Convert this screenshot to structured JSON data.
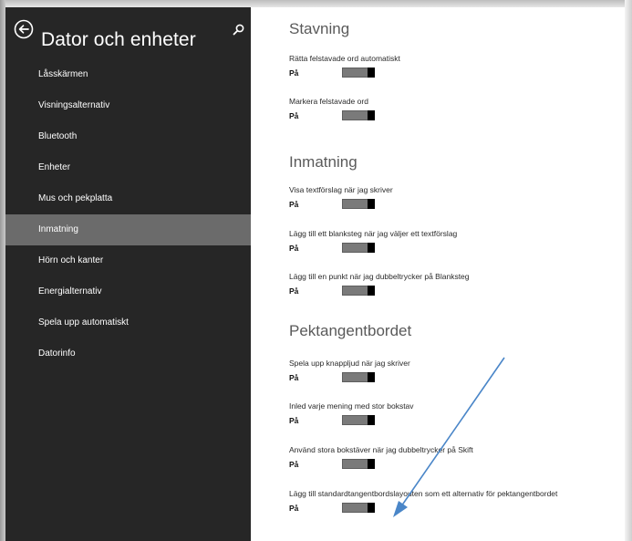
{
  "sidebar": {
    "title": "Dator och enheter",
    "back_icon": "back-arrow-circle-icon",
    "search_icon": "search-icon",
    "items": [
      {
        "label": "Låsskärmen",
        "active": false
      },
      {
        "label": "Visningsalternativ",
        "active": false
      },
      {
        "label": "Bluetooth",
        "active": false
      },
      {
        "label": "Enheter",
        "active": false
      },
      {
        "label": "Mus och pekplatta",
        "active": false
      },
      {
        "label": "Inmatning",
        "active": true
      },
      {
        "label": "Hörn och kanter",
        "active": false
      },
      {
        "label": "Energialternativ",
        "active": false
      },
      {
        "label": "Spela upp automatiskt",
        "active": false
      },
      {
        "label": "Datorinfo",
        "active": false
      }
    ]
  },
  "content": {
    "sections": [
      {
        "title": "Stavning",
        "settings": [
          {
            "label": "Rätta felstavade ord automatiskt",
            "state": "På",
            "on": true
          },
          {
            "label": "Markera felstavade ord",
            "state": "På",
            "on": true
          }
        ]
      },
      {
        "title": "Inmatning",
        "settings": [
          {
            "label": "Visa textförslag när jag skriver",
            "state": "På",
            "on": true
          },
          {
            "label": "Lägg till ett blanksteg när jag väljer ett textförslag",
            "state": "På",
            "on": true
          },
          {
            "label": "Lägg till en punkt när jag dubbeltrycker på Blanksteg",
            "state": "På",
            "on": true
          }
        ]
      },
      {
        "title": "Pektangentbordet",
        "settings": [
          {
            "label": "Spela upp knappljud när jag skriver",
            "state": "På",
            "on": true
          },
          {
            "label": "Inled varje mening med stor bokstav",
            "state": "På",
            "on": true
          },
          {
            "label": "Använd stora bokstäver när jag dubbeltrycker på Skift",
            "state": "På",
            "on": true
          },
          {
            "label": "Lägg till standardtangentbordslayouten som ett alternativ för pektangentbordet",
            "state": "På",
            "on": true
          }
        ]
      }
    ]
  },
  "annotation": {
    "color": "#4a86c8"
  },
  "colors": {
    "sidebar_bg": "#262626",
    "sidebar_active": "#6b6b6b",
    "toggle_track": "#7a7a7a",
    "toggle_thumb": "#000000"
  }
}
